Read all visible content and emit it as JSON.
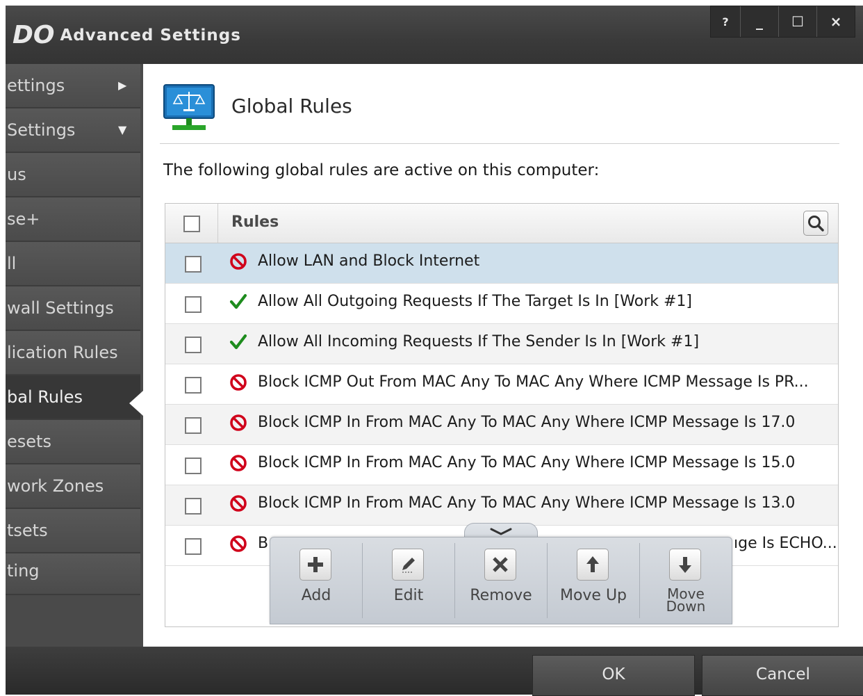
{
  "window": {
    "logo_text": "DO",
    "title": "Advanced Settings",
    "controls": {
      "help": "?",
      "minimize": "_",
      "maximize": "☐",
      "close": "×"
    }
  },
  "sidebar": {
    "items": [
      {
        "label": "ettings",
        "arrow": "▶"
      },
      {
        "label": "Settings",
        "arrow": "▼"
      },
      {
        "label": "us"
      },
      {
        "label": "se+"
      },
      {
        "label": "ll"
      },
      {
        "label": "wall Settings"
      },
      {
        "label": "lication Rules"
      },
      {
        "label": "bal Rules",
        "active": true
      },
      {
        "label": "esets"
      },
      {
        "label": "work Zones"
      },
      {
        "label": "tsets"
      },
      {
        "label": "ting"
      }
    ]
  },
  "header": {
    "title": "Global Rules",
    "icon": "balance-scale-monitor-icon"
  },
  "description": "The following global rules are active on this computer:",
  "table": {
    "column_header": "Rules",
    "search_icon": "search-icon",
    "rows": [
      {
        "status": "block",
        "text": "Allow LAN and Block Internet",
        "selected": true
      },
      {
        "status": "allow",
        "text": "Allow All Outgoing Requests If The Target Is In [Work #1]"
      },
      {
        "status": "allow",
        "text": "Allow All Incoming Requests If The Sender Is In [Work #1]"
      },
      {
        "status": "block",
        "text": "Block ICMP Out From MAC Any To MAC Any Where ICMP Message Is PR..."
      },
      {
        "status": "block",
        "text": "Block ICMP In From MAC Any To MAC Any Where ICMP Message Is 17.0"
      },
      {
        "status": "block",
        "text": "Block ICMP In From MAC Any To MAC Any Where ICMP Message Is 15.0"
      },
      {
        "status": "block",
        "text": "Block ICMP In From MAC Any To MAC Any Where ICMP Message Is 13.0"
      },
      {
        "status": "block",
        "text": "B",
        "tail": "ıge Is ECHO..."
      }
    ]
  },
  "toolbar": {
    "add": "Add",
    "edit": "Edit",
    "remove": "Remove",
    "move_up": "Move Up",
    "move_down_1": "Move",
    "move_down_2": "Down"
  },
  "footer": {
    "ok": "OK",
    "cancel": "Cancel"
  },
  "colors": {
    "block": "#d0021b",
    "allow": "#1e8c1e",
    "selected_row": "#cfe0ec"
  }
}
